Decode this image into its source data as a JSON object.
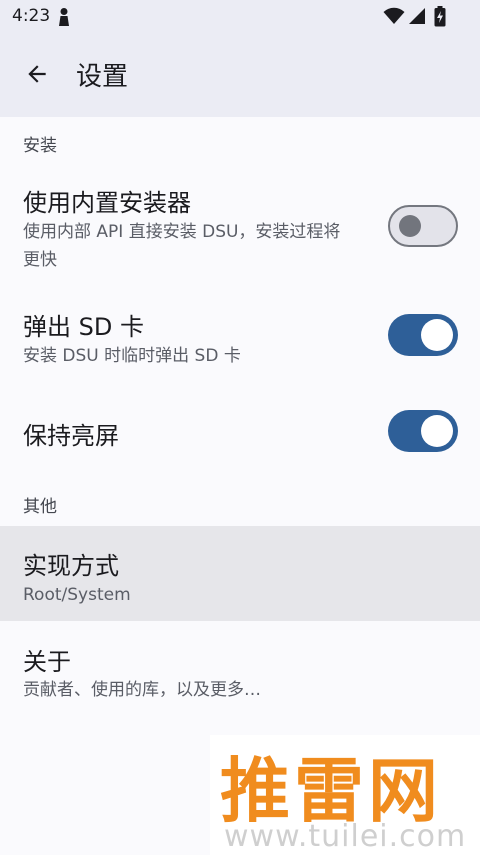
{
  "status_bar": {
    "time": "4:23",
    "icons": [
      "lock-person-icon",
      "wifi-icon",
      "signal-icon",
      "battery-charging-icon"
    ]
  },
  "app_bar": {
    "back_icon": "arrow-back-icon",
    "title": "设置"
  },
  "sections": {
    "install": {
      "header": "安装",
      "items": {
        "builtin_installer": {
          "title": "使用内置安装器",
          "summary_line1": "使用内部 API 直接安装 DSU，安装过程将",
          "summary_line2": "更快",
          "switch_on": false
        },
        "eject_sd": {
          "title": "弹出 SD 卡",
          "summary": "安装 DSU 时临时弹出 SD 卡",
          "switch_on": true
        },
        "keep_screen_on": {
          "title": "保持亮屏",
          "switch_on": true
        }
      }
    },
    "other": {
      "header": "其他",
      "items": {
        "implementation": {
          "title": "实现方式",
          "summary": "Root/System"
        },
        "about": {
          "title": "关于",
          "summary": "贡献者、使用的库，以及更多…"
        }
      }
    }
  },
  "watermark": {
    "title": "推雷网",
    "url": "www.tuilei.com"
  },
  "colors": {
    "accent": "#2e5f98",
    "app_bar_bg": "#ebecf4",
    "background": "#fafafd",
    "watermark_orange": "#f08c1e"
  }
}
